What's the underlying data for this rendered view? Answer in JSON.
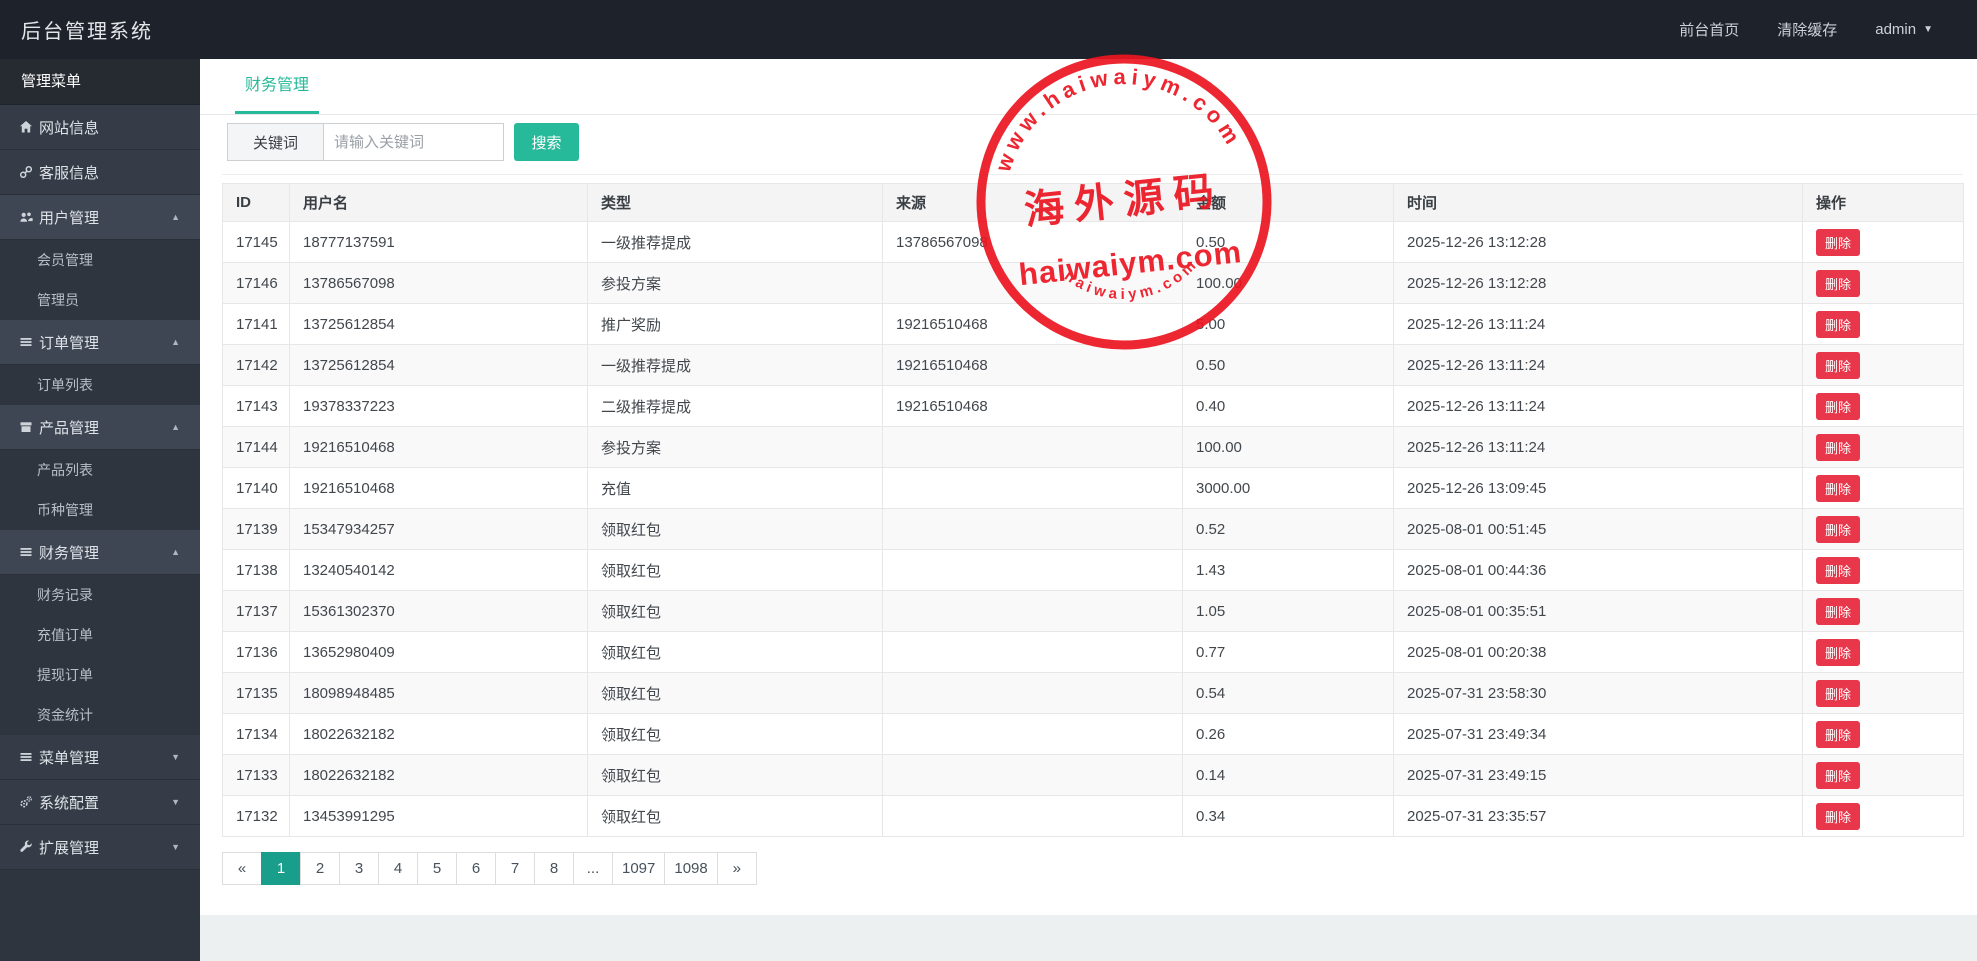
{
  "navbar": {
    "title": "后台管理系统",
    "links": [
      {
        "label": "前台首页"
      },
      {
        "label": "清除缓存"
      }
    ],
    "user": {
      "name": "admin"
    }
  },
  "sidebar": {
    "section_header": "管理菜单",
    "items": [
      {
        "key": "site-info",
        "label": "网站信息",
        "icon": "home-icon"
      },
      {
        "key": "service-info",
        "label": "客服信息",
        "icon": "link-icon"
      },
      {
        "key": "user-manage",
        "label": "用户管理",
        "icon": "users-icon",
        "state": "expanded",
        "children": [
          {
            "key": "member-manage",
            "label": "会员管理"
          },
          {
            "key": "admin-manage",
            "label": "管理员"
          }
        ]
      },
      {
        "key": "order-manage",
        "label": "订单管理",
        "icon": "list-icon",
        "state": "expanded",
        "children": [
          {
            "key": "order-list",
            "label": "订单列表"
          }
        ]
      },
      {
        "key": "product-manage",
        "label": "产品管理",
        "icon": "box-icon",
        "state": "expanded",
        "children": [
          {
            "key": "product-list",
            "label": "产品列表"
          },
          {
            "key": "coin-manage",
            "label": "币种管理"
          }
        ]
      },
      {
        "key": "finance-manage",
        "label": "财务管理",
        "icon": "list-icon",
        "state": "expanded",
        "children": [
          {
            "key": "finance-record",
            "label": "财务记录"
          },
          {
            "key": "recharge-order",
            "label": "充值订单"
          },
          {
            "key": "withdraw-order",
            "label": "提现订单"
          },
          {
            "key": "fund-stats",
            "label": "资金统计"
          }
        ]
      },
      {
        "key": "menu-manage",
        "label": "菜单管理",
        "icon": "list-icon",
        "state": "collapsed",
        "children": []
      },
      {
        "key": "system-config",
        "label": "系统配置",
        "icon": "gears-icon",
        "state": "collapsed",
        "children": []
      },
      {
        "key": "extend-manage",
        "label": "扩展管理",
        "icon": "wrench-icon",
        "state": "collapsed",
        "children": []
      }
    ]
  },
  "tab": {
    "label": "财务管理"
  },
  "search": {
    "label": "关键词",
    "placeholder": "请输入关键词",
    "button": "搜索"
  },
  "table": {
    "headers": [
      "ID",
      "用户名",
      "类型",
      "来源",
      "金额",
      "时间",
      "操作"
    ],
    "delete_label": "删除",
    "rows": [
      [
        "17145",
        "18777137591",
        "一级推荐提成",
        "13786567098",
        "0.50",
        "2025-12-26 13:12:28"
      ],
      [
        "17146",
        "13786567098",
        "参投方案",
        "",
        "100.00",
        "2025-12-26 13:12:28"
      ],
      [
        "17141",
        "13725612854",
        "推广奖励",
        "19216510468",
        "5.00",
        "2025-12-26 13:11:24"
      ],
      [
        "17142",
        "13725612854",
        "一级推荐提成",
        "19216510468",
        "0.50",
        "2025-12-26 13:11:24"
      ],
      [
        "17143",
        "19378337223",
        "二级推荐提成",
        "19216510468",
        "0.40",
        "2025-12-26 13:11:24"
      ],
      [
        "17144",
        "19216510468",
        "参投方案",
        "",
        "100.00",
        "2025-12-26 13:11:24"
      ],
      [
        "17140",
        "19216510468",
        "充值",
        "",
        "3000.00",
        "2025-12-26 13:09:45"
      ],
      [
        "17139",
        "15347934257",
        "领取红包",
        "",
        "0.52",
        "2025-08-01 00:51:45"
      ],
      [
        "17138",
        "13240540142",
        "领取红包",
        "",
        "1.43",
        "2025-08-01 00:44:36"
      ],
      [
        "17137",
        "15361302370",
        "领取红包",
        "",
        "1.05",
        "2025-08-01 00:35:51"
      ],
      [
        "17136",
        "13652980409",
        "领取红包",
        "",
        "0.77",
        "2025-08-01 00:20:38"
      ],
      [
        "17135",
        "18098948485",
        "领取红包",
        "",
        "0.54",
        "2025-07-31 23:58:30"
      ],
      [
        "17134",
        "18022632182",
        "领取红包",
        "",
        "0.26",
        "2025-07-31 23:49:34"
      ],
      [
        "17133",
        "18022632182",
        "领取红包",
        "",
        "0.14",
        "2025-07-31 23:49:15"
      ],
      [
        "17132",
        "13453991295",
        "领取红包",
        "",
        "0.34",
        "2025-07-31 23:35:57"
      ]
    ]
  },
  "pagination": {
    "prev": "«",
    "next": "»",
    "active": "1",
    "pages": [
      "1",
      "2",
      "3",
      "4",
      "5",
      "6",
      "7",
      "8",
      "...",
      "1097",
      "1098"
    ]
  },
  "watermark": {
    "arc_top": "www.haiwaiym.com",
    "center_cn": "海外源码",
    "center_en": "haiwaiym.com",
    "arc_bottom": "haiwaiym.com",
    "color": "#ec1520"
  },
  "colors": {
    "accent": "#26b99a",
    "danger": "#e8364a",
    "navbar": "#1e232b",
    "sidebar": "#2f353e"
  }
}
